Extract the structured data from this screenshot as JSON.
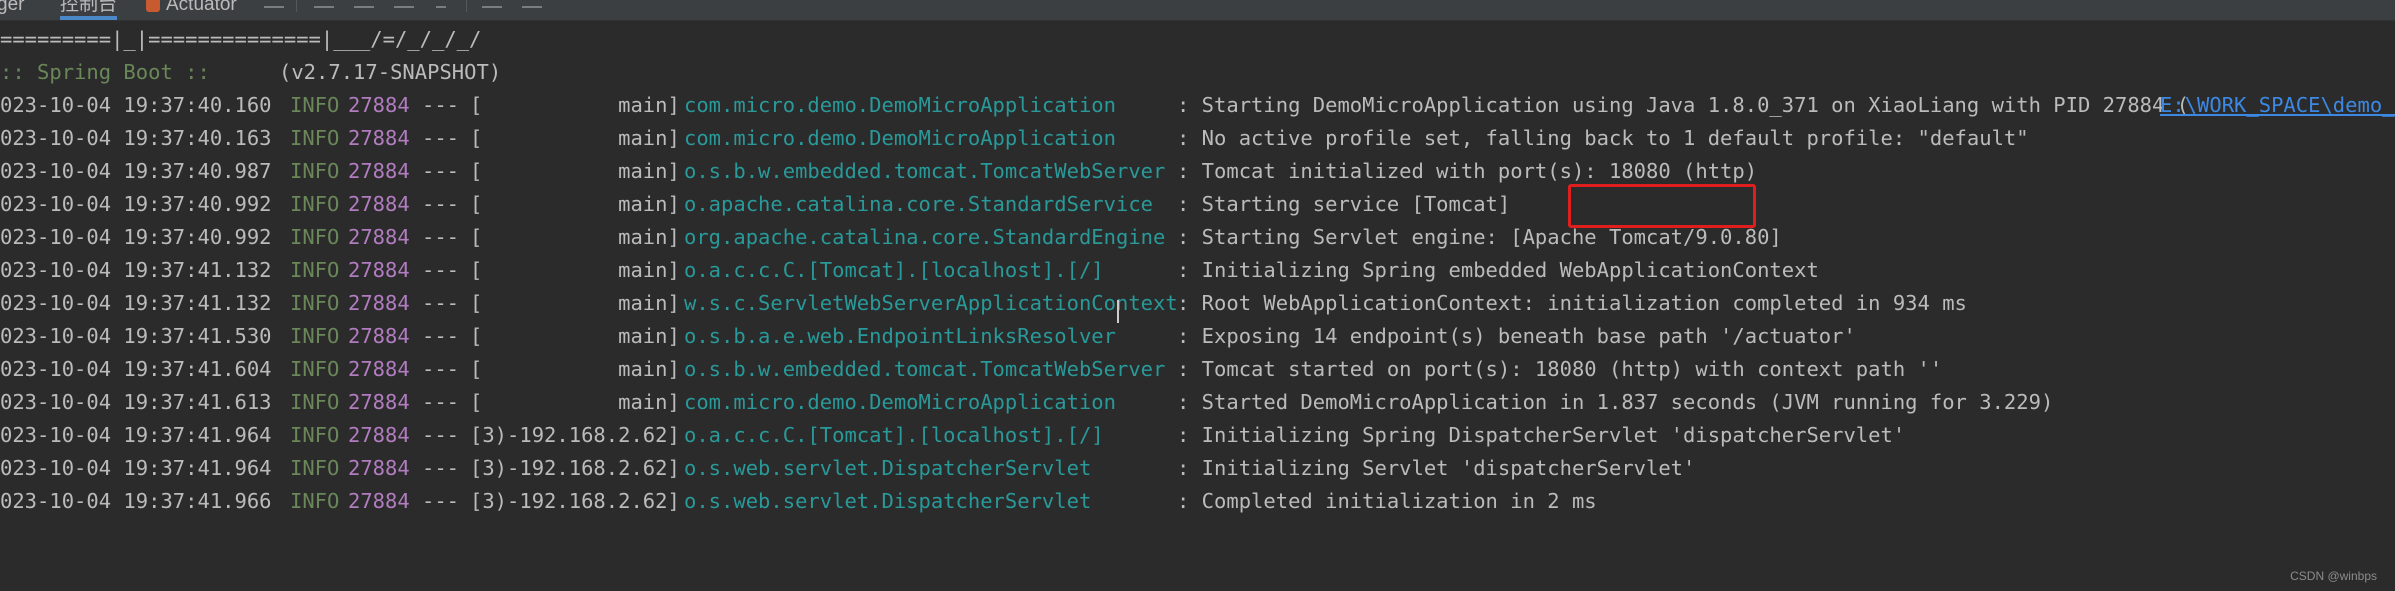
{
  "tabs": {
    "left_partial": "ger",
    "console": "控制台",
    "actuator": "Actuator"
  },
  "banner": {
    "art_line": "=========|_|==============|___/=/_/_/_/",
    "spring_label": ":: Spring Boot ::",
    "version": "(v2.7.17-SNAPSHOT)"
  },
  "logs": [
    {
      "ts": "023-10-04 19:37:40.160",
      "level": "INFO",
      "pid": "27884",
      "sep": "---",
      "thread": "[           main]",
      "logger": "com.micro.demo.DemoMicroApplication",
      "msg": ": Starting DemoMicroApplication using Java 1.8.0_371 on XiaoLiang with PID 27884 (",
      "link": "E:\\WORK_SPACE\\demo_m"
    },
    {
      "ts": "023-10-04 19:37:40.163",
      "level": "INFO",
      "pid": "27884",
      "sep": "---",
      "thread": "[           main]",
      "logger": "com.micro.demo.DemoMicroApplication",
      "msg": ": No active profile set, falling back to 1 default profile: \"default\""
    },
    {
      "ts": "023-10-04 19:37:40.987",
      "level": "INFO",
      "pid": "27884",
      "sep": "---",
      "thread": "[           main]",
      "logger": "o.s.b.w.embedded.tomcat.TomcatWebServer",
      "msg": ": Tomcat initialized with port(s): 18080 (http)"
    },
    {
      "ts": "023-10-04 19:37:40.992",
      "level": "INFO",
      "pid": "27884",
      "sep": "---",
      "thread": "[           main]",
      "logger": "o.apache.catalina.core.StandardService",
      "msg": ": Starting service [Tomcat]"
    },
    {
      "ts": "023-10-04 19:37:40.992",
      "level": "INFO",
      "pid": "27884",
      "sep": "---",
      "thread": "[           main]",
      "logger": "org.apache.catalina.core.StandardEngine",
      "msg": ": Starting Servlet engine: [Apache Tomcat/9.0.80]"
    },
    {
      "ts": "023-10-04 19:37:41.132",
      "level": "INFO",
      "pid": "27884",
      "sep": "---",
      "thread": "[           main]",
      "logger": "o.a.c.c.C.[Tomcat].[localhost].[/]",
      "msg": ": Initializing Spring embedded WebApplicationContext"
    },
    {
      "ts": "023-10-04 19:37:41.132",
      "level": "INFO",
      "pid": "27884",
      "sep": "---",
      "thread": "[           main]",
      "logger": "w.s.c.ServletWebServerApplicationContext",
      "msg": ": Root WebApplicationContext: initialization completed in 934 ms"
    },
    {
      "ts": "023-10-04 19:37:41.530",
      "level": "INFO",
      "pid": "27884",
      "sep": "---",
      "thread": "[           main]",
      "logger": "o.s.b.a.e.web.EndpointLinksResolver",
      "msg": ": Exposing 14 endpoint(s) beneath base path '/actuator'"
    },
    {
      "ts": "023-10-04 19:37:41.604",
      "level": "INFO",
      "pid": "27884",
      "sep": "---",
      "thread": "[           main]",
      "logger": "o.s.b.w.embedded.tomcat.TomcatWebServer",
      "msg": ": Tomcat started on port(s): 18080 (http) with context path ''"
    },
    {
      "ts": "023-10-04 19:37:41.613",
      "level": "INFO",
      "pid": "27884",
      "sep": "---",
      "thread": "[           main]",
      "logger": "com.micro.demo.DemoMicroApplication",
      "msg": ": Started DemoMicroApplication in 1.837 seconds (JVM running for 3.229)"
    },
    {
      "ts": "023-10-04 19:37:41.964",
      "level": "INFO",
      "pid": "27884",
      "sep": "---",
      "thread": "[3)-192.168.2.62]",
      "logger": "o.a.c.c.C.[Tomcat].[localhost].[/]",
      "msg": ": Initializing Spring DispatcherServlet 'dispatcherServlet'"
    },
    {
      "ts": "023-10-04 19:37:41.964",
      "level": "INFO",
      "pid": "27884",
      "sep": "---",
      "thread": "[3)-192.168.2.62]",
      "logger": "o.s.web.servlet.DispatcherServlet",
      "msg": ": Initializing Servlet 'dispatcherServlet'"
    },
    {
      "ts": "023-10-04 19:37:41.966",
      "level": "INFO",
      "pid": "27884",
      "sep": "---",
      "thread": "[3)-192.168.2.62]",
      "logger": "o.s.web.servlet.DispatcherServlet",
      "msg": ": Completed initialization in 2 ms"
    }
  ],
  "watermark": "CSDN @winbps",
  "colors": {
    "background": "#2b2b2b",
    "level_info": "#6a8759",
    "pid": "#b27cc1",
    "logger": "#299999",
    "link": "#3d88e3",
    "highlight": "#e01e1e"
  },
  "icons": [
    "menu-icon",
    "align-top-icon",
    "align-middle-icon",
    "align-bottom-icon",
    "filter-icon",
    "grid-icon",
    "settings-icon"
  ]
}
